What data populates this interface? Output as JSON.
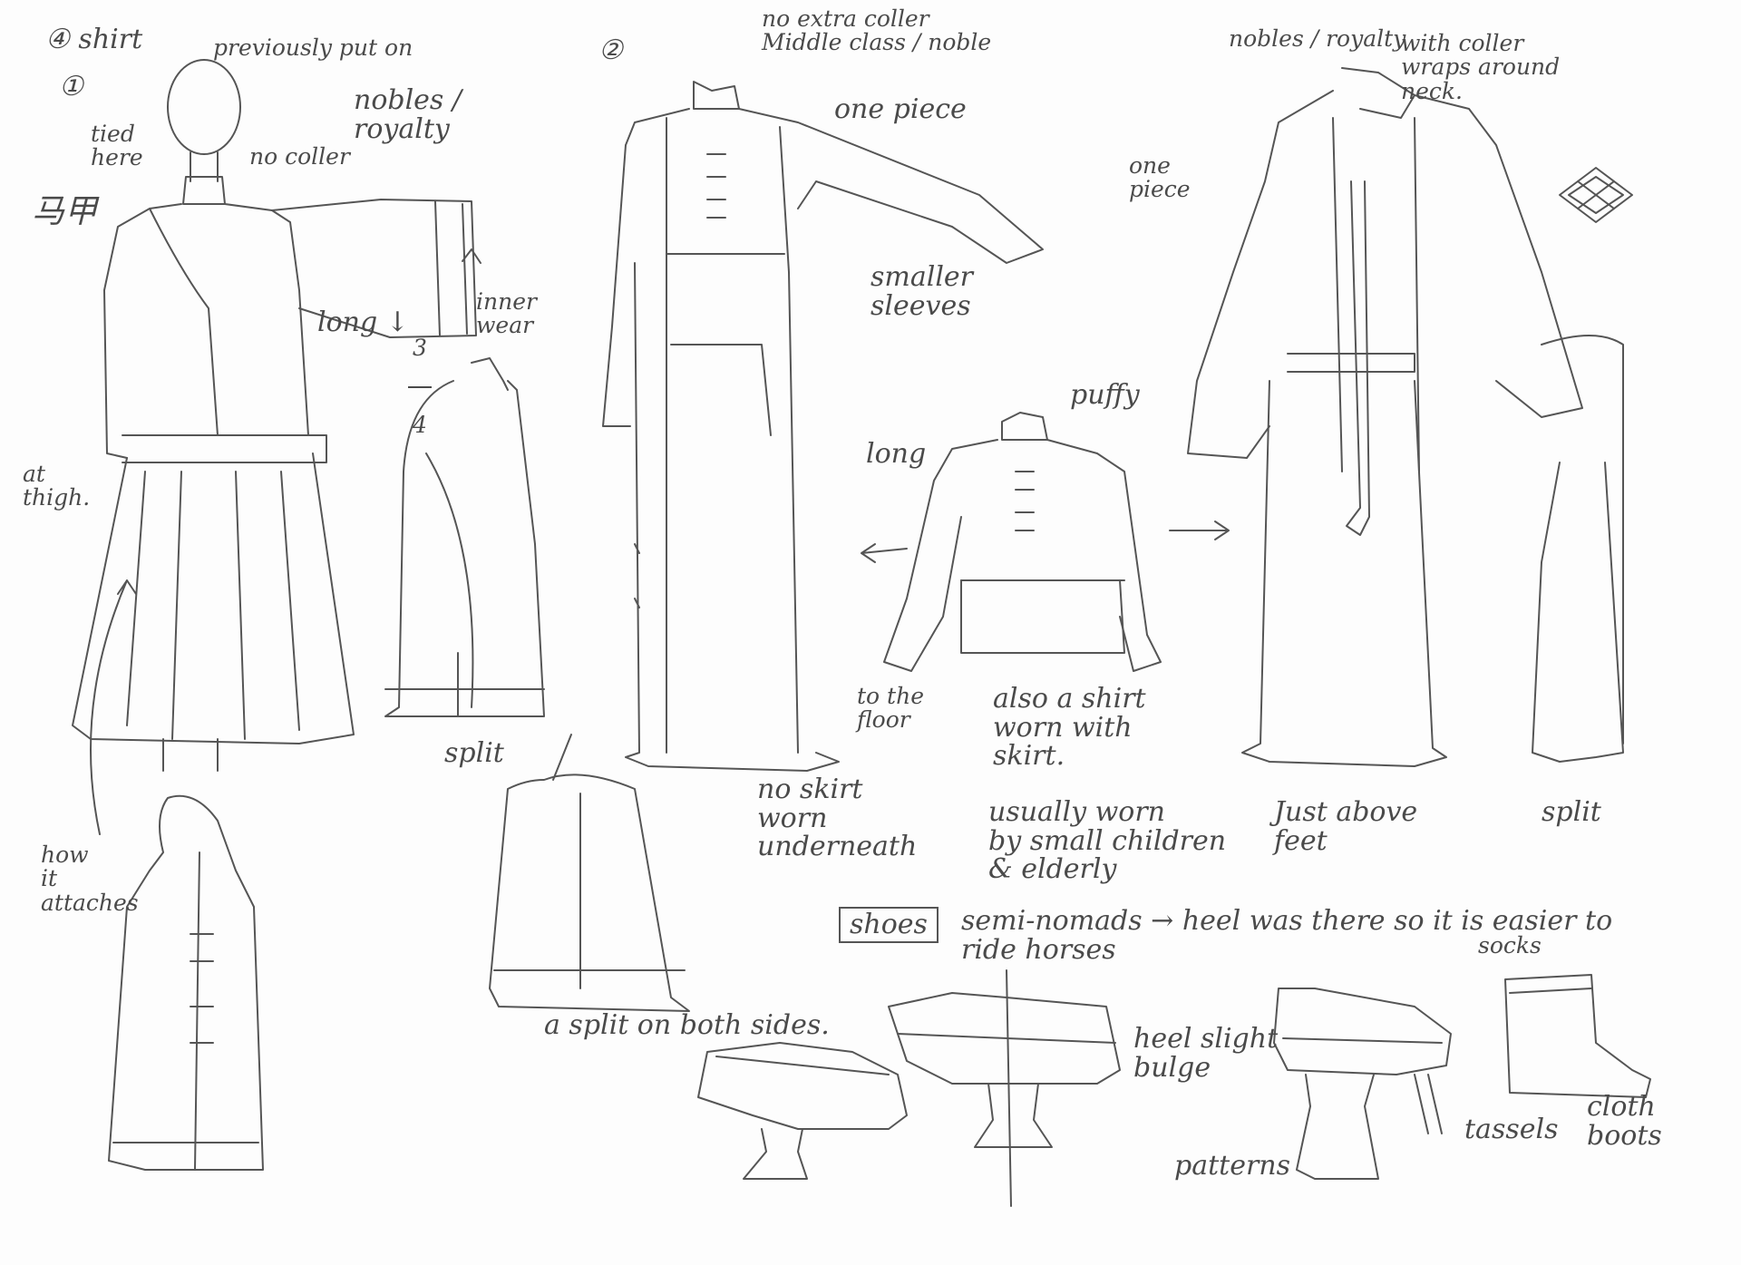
{
  "notes": {
    "shirt_header": "④ shirt",
    "previously_put_on": "previously put on",
    "num_1": "①",
    "tied_here": "tied\nhere",
    "no_collar_1": "no coller",
    "nobles_royalty_1": "nobles /\nroyalty",
    "chinese_chars": "马甲",
    "inner_wear": "inner\nwear",
    "long_1": "long ↓",
    "frac_num": "3",
    "frac_den": "4",
    "at_thigh": "at\nthigh.",
    "split_1": "split",
    "how_it_attaches": "how\nit\nattaches",
    "num_2": "②",
    "no_extra_collar": "no extra coller\nMiddle class / noble",
    "one_piece_1": "one piece",
    "smaller_sleeves": "smaller\nsleeves",
    "puffy": "puffy",
    "long_2": "long",
    "to_the_floor": "to the\nfloor",
    "also_a_shirt": "also a shirt\nworn with\nskirt.",
    "usually_worn": "usually worn\nby small children\n& elderly",
    "no_skirt": "no skirt\nworn\nunderneath",
    "nobles_royalty_2": "nobles / royalty",
    "with_collar": "with coller\nwraps around\nneck.",
    "one_piece_2": "one\npiece",
    "just_above_feet": "Just above\nfeet",
    "split_2": "split",
    "a_split_both": "a split on both sides.",
    "shoes_label": "shoes",
    "semi_nomads": "semi-nomads → heel was there so it is easier to\nride horses",
    "socks": "socks",
    "heel_slight": "heel slight\nbulge",
    "patterns": "patterns",
    "tassels": "tassels",
    "cloth_boots": "cloth\nboots"
  },
  "colors": {
    "pencil": "#4a4a4a",
    "paper": "#fdfdfd"
  }
}
